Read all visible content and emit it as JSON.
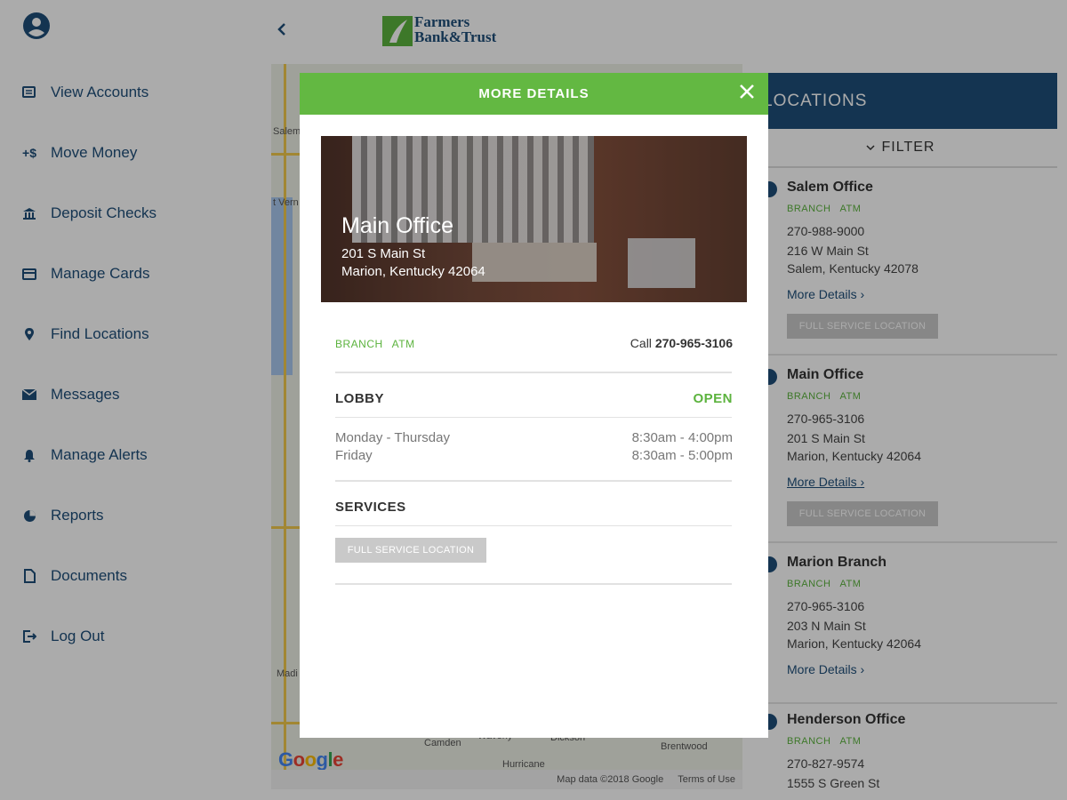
{
  "sidebar": {
    "items": [
      {
        "label": "View Accounts",
        "icon": "accounts-icon"
      },
      {
        "label": "Move Money",
        "icon": "transfer-icon"
      },
      {
        "label": "Deposit Checks",
        "icon": "bank-icon"
      },
      {
        "label": "Manage Cards",
        "icon": "card-icon"
      },
      {
        "label": "Find Locations",
        "icon": "location-pin-icon"
      },
      {
        "label": "Messages",
        "icon": "envelope-icon"
      },
      {
        "label": "Manage Alerts",
        "icon": "bell-icon"
      },
      {
        "label": "Reports",
        "icon": "pie-chart-icon"
      },
      {
        "label": "Documents",
        "icon": "document-icon"
      },
      {
        "label": "Log Out",
        "icon": "logout-icon"
      }
    ]
  },
  "header": {
    "logo_line1": "Farmers",
    "logo_line2": "Bank&Trust"
  },
  "map": {
    "google": "Google",
    "footer_data": "Map data ©2018 Google",
    "footer_terms": "Terms of Use",
    "labels": [
      "Salem",
      "t Vern",
      "Camden",
      "Waverly",
      "Dickson",
      "Brentwood",
      "Hurricane",
      "Madi"
    ]
  },
  "locations_panel": {
    "title": "LOCATIONS",
    "filter_label": "FILTER",
    "cards": [
      {
        "name": "Salem Office",
        "tag1": "BRANCH",
        "tag2": "ATM",
        "phone": "270-988-9000",
        "street": "216 W Main St",
        "city": "Salem, Kentucky 42078",
        "more": "More Details",
        "badge": "FULL SERVICE LOCATION"
      },
      {
        "name": "Main Office",
        "tag1": "BRANCH",
        "tag2": "ATM",
        "phone": "270-965-3106",
        "street": "201 S Main St",
        "city": "Marion, Kentucky 42064",
        "more": "More Details",
        "badge": "FULL SERVICE LOCATION"
      },
      {
        "name": "Marion Branch",
        "tag1": "BRANCH",
        "tag2": "ATM",
        "phone": "270-965-3106",
        "street": "203 N Main St",
        "city": "Marion, Kentucky 42064",
        "more": "More Details"
      },
      {
        "name": "Henderson Office",
        "tag1": "BRANCH",
        "tag2": "ATM",
        "phone": "270-827-9574",
        "street": "1555 S Green St"
      }
    ]
  },
  "modal": {
    "title": "MORE DETAILS",
    "hero": {
      "name": "Main Office",
      "street": "201 S Main St",
      "city": "Marion, Kentucky 42064"
    },
    "tag1": "BRANCH",
    "tag2": "ATM",
    "call_label": "Call",
    "call_number": "270-965-3106",
    "lobby_title": "LOBBY",
    "lobby_status": "OPEN",
    "hours": [
      {
        "day": "Monday - Thursday",
        "time": "8:30am - 4:00pm"
      },
      {
        "day": "Friday",
        "time": "8:30am - 5:00pm"
      }
    ],
    "services_title": "SERVICES",
    "service_badge": "FULL SERVICE LOCATION"
  },
  "colors": {
    "primary": "#1e4e79",
    "accent": "#63b842",
    "overlay": "rgba(0,0,0,0.33)"
  }
}
